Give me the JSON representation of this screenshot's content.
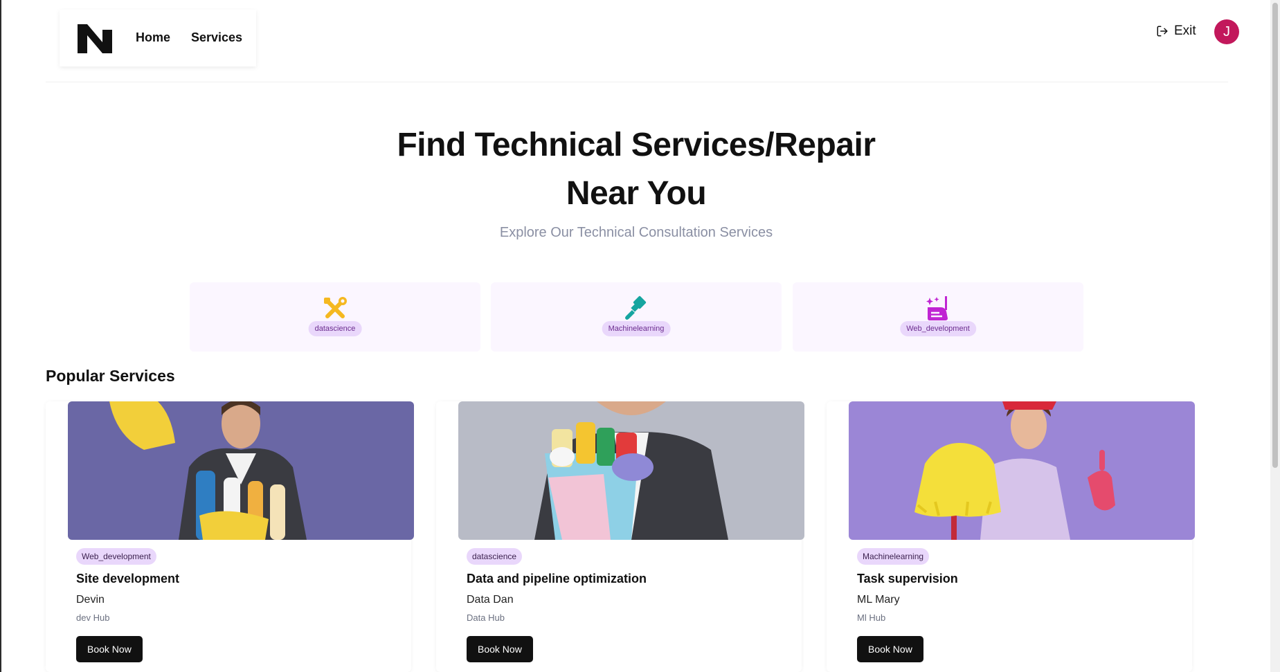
{
  "header": {
    "nav": {
      "home_label": "Home",
      "services_label": "Services"
    },
    "exit_label": "Exit",
    "avatar_initial": "J"
  },
  "hero": {
    "title_line1": "Find Technical Services/Repair",
    "title_line2": "Near You",
    "subtitle": "Explore Our Technical Consultation Services"
  },
  "categories": [
    {
      "label": "datascience",
      "icon": "tools-icon",
      "color": "#f5b820"
    },
    {
      "label": "Machinelearning",
      "icon": "paint-brush-icon",
      "color": "#16a5a0"
    },
    {
      "label": "Web_development",
      "icon": "cleaning-sparkle-icon",
      "color": "#c025d3"
    }
  ],
  "popular": {
    "title": "Popular Services",
    "items": [
      {
        "category": "Web_development",
        "title": "Site development",
        "provider": "Devin",
        "hub": "dev Hub",
        "button": "Book Now"
      },
      {
        "category": "datascience",
        "title": "Data and pipeline optimization",
        "provider": "Data Dan",
        "hub": "Data Hub",
        "button": "Book Now"
      },
      {
        "category": "Machinelearning",
        "title": "Task supervision",
        "provider": "ML Mary",
        "hub": "Ml Hub",
        "button": "Book Now"
      }
    ]
  },
  "colors": {
    "accent_pill": "#e9d7fb",
    "category_bg": "#fbf6ff",
    "avatar": "#c2185b",
    "button": "#111111"
  }
}
